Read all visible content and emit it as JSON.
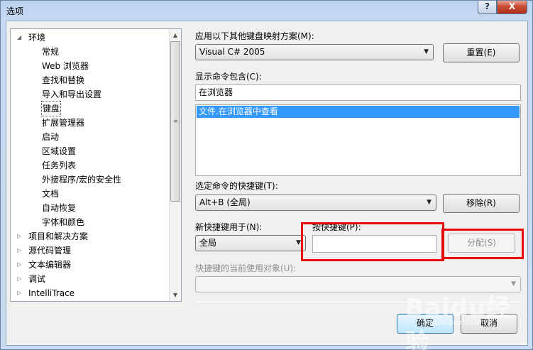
{
  "window": {
    "title": "选项",
    "help_label": "?",
    "close_label": "X"
  },
  "tree": {
    "items": [
      {
        "label": "环境",
        "level": 0,
        "expanded": true
      },
      {
        "label": "常规",
        "level": 1
      },
      {
        "label": "Web 浏览器",
        "level": 1
      },
      {
        "label": "查找和替换",
        "level": 1
      },
      {
        "label": "导入和导出设置",
        "level": 1
      },
      {
        "label": "键盘",
        "level": 1,
        "selected": true
      },
      {
        "label": "扩展管理器",
        "level": 1
      },
      {
        "label": "启动",
        "level": 1
      },
      {
        "label": "区域设置",
        "level": 1
      },
      {
        "label": "任务列表",
        "level": 1
      },
      {
        "label": "外接程序/宏的安全性",
        "level": 1
      },
      {
        "label": "文档",
        "level": 1
      },
      {
        "label": "自动恢复",
        "level": 1
      },
      {
        "label": "字体和颜色",
        "level": 1
      },
      {
        "label": "项目和解决方案",
        "level": 0,
        "expanded": false
      },
      {
        "label": "源代码管理",
        "level": 0,
        "expanded": false
      },
      {
        "label": "文本编辑器",
        "level": 0,
        "expanded": false
      },
      {
        "label": "调试",
        "level": 0,
        "expanded": false
      },
      {
        "label": "IntelliTrace",
        "level": 0,
        "expanded": false
      }
    ],
    "scroll_grip": "≡"
  },
  "keyboard": {
    "mapping_label": "应用以下其他键盘映射方案(M):",
    "mapping_value": "Visual C# 2005",
    "reset_label": "重置(E)",
    "contains_label": "显示命令包含(C):",
    "contains_value": "在浏览器",
    "commands": [
      "文件.在浏览器中查看"
    ],
    "shortcuts_label": "选定命令的快捷键(T):",
    "shortcuts_value": "Alt+B (全局)",
    "remove_label": "移除(R)",
    "use_in_label": "新快捷键用于(N):",
    "use_in_value": "全局",
    "press_keys_label": "按快捷键(P):",
    "press_keys_value": "",
    "assign_label": "分配(S)",
    "currently_used_label": "快捷键的当前使用对象(U):",
    "currently_used_value": ""
  },
  "footer": {
    "ok_label": "确定",
    "cancel_label": "取消"
  },
  "watermark": {
    "text": "Baidu经验",
    "sub": "jingyan.baidu.com"
  },
  "colors": {
    "highlight": "#e8090d",
    "selection": "#3399ff"
  }
}
